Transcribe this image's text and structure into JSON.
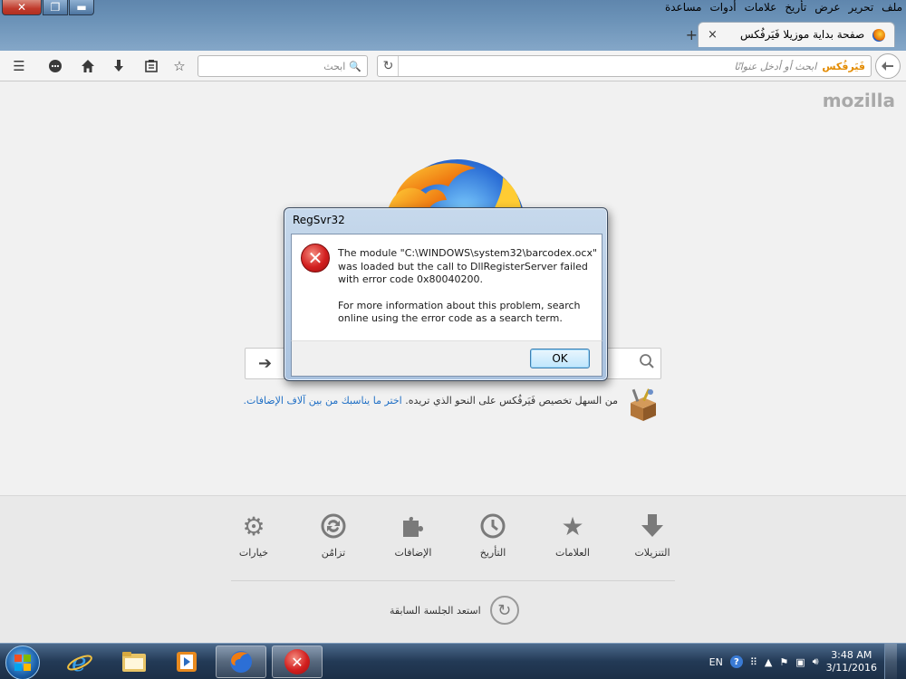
{
  "window": {
    "close_label": "✕",
    "max_label": "❐",
    "min_label": "▬",
    "menu": [
      "ملف",
      "تحرير",
      "عرض",
      "تأريخ",
      "علامات",
      "أدوات",
      "مساعدة"
    ]
  },
  "tab": {
    "title": "صفحة بداية موزيلا فَيَرفُكس",
    "close": "×",
    "new_tab": "+"
  },
  "navbar": {
    "search_placeholder": "ابحث",
    "url_brand": "فَيَرفُكس",
    "url_placeholder": "ابحث أو أدخل عنوانًا"
  },
  "content": {
    "brand": "mozilla",
    "snippet_text": "من السهل تخصيص فَيَرفُكس على النحو الذي تريده. ",
    "snippet_link": "اختر ما يناسبك من بين آلاف الإضافات."
  },
  "launcher": {
    "items": [
      {
        "label": "التنزيلات",
        "icon": "download-icon"
      },
      {
        "label": "العلامات",
        "icon": "star-icon"
      },
      {
        "label": "التأريخ",
        "icon": "clock-icon"
      },
      {
        "label": "الإضافات",
        "icon": "puzzle-icon"
      },
      {
        "label": "تزامُن",
        "icon": "sync-icon"
      },
      {
        "label": "خيارات",
        "icon": "gear-icon"
      }
    ],
    "restore_label": "استعد الجلسة السابقة"
  },
  "dialog": {
    "title": "RegSvr32",
    "message_1": "The module \"C:\\WINDOWS\\system32\\barcodex.ocx\" was loaded but the call to DllRegisterServer failed with error code 0x80040200.",
    "message_2": "For more information about this problem, search online using the error code as a search term.",
    "ok_label": "OK"
  },
  "taskbar": {
    "lang": "EN",
    "time": "3:48 AM",
    "date": "3/11/2016"
  }
}
